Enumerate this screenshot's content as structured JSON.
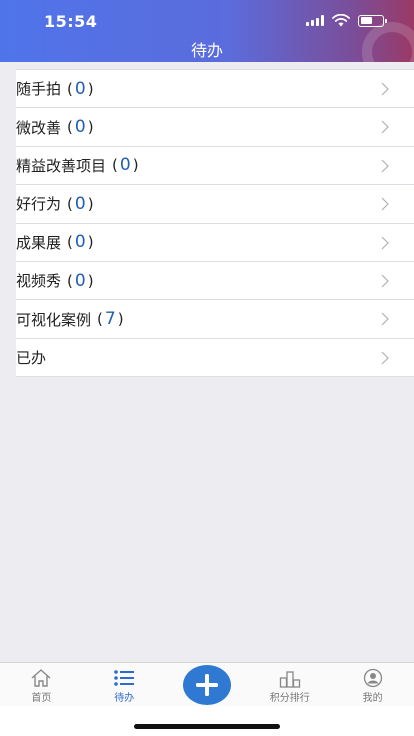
{
  "status_bar": {
    "time": "15:54"
  },
  "header": {
    "title": "待办"
  },
  "list": [
    {
      "label": "随手拍",
      "count": "0"
    },
    {
      "label": "微改善",
      "count": "0"
    },
    {
      "label": "精益改善项目",
      "count": "0"
    },
    {
      "label": "好行为",
      "count": "0"
    },
    {
      "label": "成果展",
      "count": "0"
    },
    {
      "label": "视频秀",
      "count": "0"
    },
    {
      "label": "可视化案例",
      "count": "7"
    },
    {
      "label": "已办",
      "count": null
    }
  ],
  "tabbar": {
    "home": "首页",
    "todo": "待办",
    "ranking": "积分排行",
    "mine": "我的",
    "active": "todo"
  },
  "colors": {
    "accent": "#2e6bd1",
    "count": "#1f5fb8",
    "header_start": "#4f74ea",
    "header_end": "#9a3a66"
  }
}
